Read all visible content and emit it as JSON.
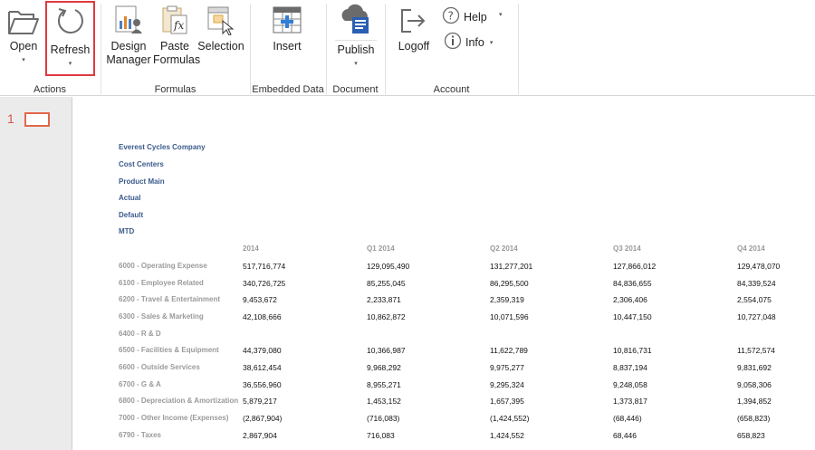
{
  "ribbon": {
    "buttons": [
      {
        "id": "open",
        "label": "Open",
        "caret": "▾"
      },
      {
        "id": "refresh",
        "label": "Refresh",
        "caret": "▾"
      },
      {
        "id": "design",
        "label": "Design\nManager"
      },
      {
        "id": "paste",
        "label": "Paste\nFormulas"
      },
      {
        "id": "selection",
        "label": "Selection"
      },
      {
        "id": "insert",
        "label": "Insert"
      },
      {
        "id": "publish",
        "label": "Publish",
        "caret": "▾"
      },
      {
        "id": "logoff",
        "label": "Logoff"
      }
    ],
    "help": {
      "label": "Help",
      "caret": "▾"
    },
    "info": {
      "label": "Info",
      "caret": "▾"
    },
    "groups": [
      "Actions",
      "Formulas",
      "Embedded Data",
      "Document",
      "Account"
    ]
  },
  "pages": {
    "current": "1"
  },
  "report": {
    "headers": [
      "Everest Cycles Company",
      "Cost Centers",
      "Product Main",
      "Actual",
      "Default",
      "MTD"
    ],
    "columns": [
      "2014",
      "Q1 2014",
      "Q2 2014",
      "Q3 2014",
      "Q4 2014"
    ],
    "rows": [
      {
        "label": "6000 - Operating Expense",
        "values": [
          "517,716,774",
          "129,095,490",
          "131,277,201",
          "127,866,012",
          "129,478,070"
        ]
      },
      {
        "label": "6100 - Employee Related",
        "values": [
          "340,726,725",
          "85,255,045",
          "86,295,500",
          "84,836,655",
          "84,339,524"
        ]
      },
      {
        "label": "6200 - Travel & Entertainment",
        "values": [
          "9,453,672",
          "2,233,871",
          "2,359,319",
          "2,306,406",
          "2,554,075"
        ]
      },
      {
        "label": "6300 - Sales & Marketing",
        "values": [
          "42,108,666",
          "10,862,872",
          "10,071,596",
          "10,447,150",
          "10,727,048"
        ]
      },
      {
        "label": "6400 - R & D",
        "values": [
          "",
          "",
          "",
          "",
          ""
        ]
      },
      {
        "label": "6500 - Facilities & Equipment",
        "values": [
          "44,379,080",
          "10,366,987",
          "11,622,789",
          "10,816,731",
          "11,572,574"
        ]
      },
      {
        "label": "6600 - Outside Services",
        "values": [
          "38,612,454",
          "9,968,292",
          "9,975,277",
          "8,837,194",
          "9,831,692"
        ]
      },
      {
        "label": "6700 - G & A",
        "values": [
          "36,556,960",
          "8,955,271",
          "9,295,324",
          "9,248,058",
          "9,058,306"
        ]
      },
      {
        "label": "6800 - Depreciation & Amortization",
        "values": [
          "5,879,217",
          "1,453,152",
          "1,657,395",
          "1,373,817",
          "1,394,852"
        ]
      },
      {
        "label": "7000 - Other Income (Expenses)",
        "values": [
          "(2,867,904)",
          "(716,083)",
          "(1,424,552)",
          "(68,446)",
          "(658,823)"
        ]
      },
      {
        "label": "6790 - Taxes",
        "values": [
          "2,867,904",
          "716,083",
          "1,424,552",
          "68,446",
          "658,823"
        ]
      }
    ]
  }
}
